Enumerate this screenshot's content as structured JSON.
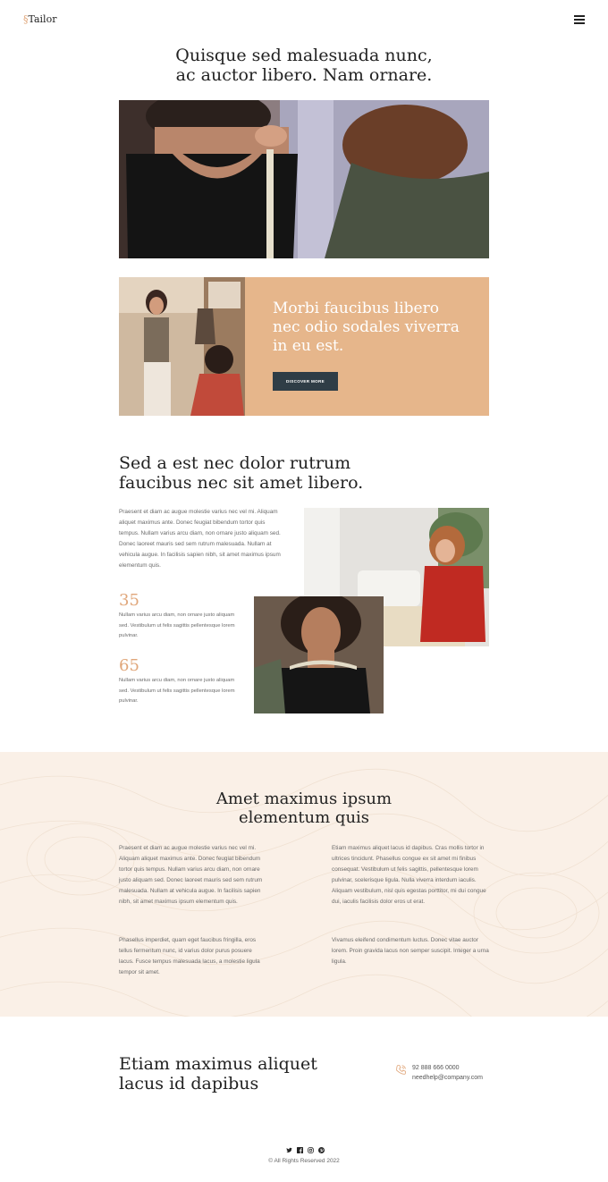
{
  "header": {
    "logo_mark": "§",
    "logo_text": "Tailor",
    "menu_icon": "hamburger-menu-icon"
  },
  "hero": {
    "title": "Quisque sed malesuada nunc, ac auctor libero. Nam ornare."
  },
  "promo": {
    "title": "Morbi faucibus libero nec odio sodales viverra in eu est.",
    "button_label": "DISCOVER MORE",
    "bg_color": "#e6b68b"
  },
  "about": {
    "title": "Sed a est nec dolor rutrum faucibus nec sit amet libero.",
    "body": "Praesent et diam ac augue molestie varius nec vel mi. Aliquam aliquet maximus ante. Donec feugiat bibendum tortor quis tempus. Nullam varius arcu diam, non ornare justo aliquam sed. Donec laoreet mauris sed sem rutrum malesuada. Nullam at vehicula augue. In facilisis sapien nibh, sit amet maximus ipsum elementum quis.",
    "stats": [
      {
        "number": "35",
        "text": "Nullam varius arcu diam, non ornare justo aliquam sed. Vestibulum ut felis sagittis pellentesque lorem pulvinar."
      },
      {
        "number": "65",
        "text": "Nullam varius arcu diam, non ornare justo aliquam sed. Vestibulum ut felis sagittis pellentesque lorem pulvinar."
      }
    ],
    "accent_color": "#e0a67a"
  },
  "features": {
    "title": "Amet maximus ipsum elementum quis",
    "bg_color": "#faf0e7",
    "col1_p1": "Praesent et diam ac augue molestie varius nec vel mi. Aliquam aliquet maximus ante. Donec feugiat bibendum tortor quis tempus. Nullam varius arcu diam, non ornare justo aliquam sed. Donec laoreet mauris sed sem rutrum malesuada. Nullam at vehicula augue. In facilisis sapien nibh, sit amet maximus ipsum elementum quis.",
    "col1_p2": "Phasellus imperdiet, quam eget faucibus fringilla, eros tellus fermentum nunc, id varius dolor purus posuere lacus. Fusce tempus malesuada lacus, a molestie ligula tempor sit amet.",
    "col2_p1": "Etiam maximus aliquet lacus id dapibus. Cras mollis tortor in ultrices tincidunt. Phasellus congue ex sit amet mi finibus consequat. Vestibulum ut felis sagittis, pellentesque lorem pulvinar, scelerisque ligula. Nulla viverra interdum iaculis. Aliquam vestibulum, nisl quis egestas porttitor, mi dui congue dui, iaculis facilisis dolor eros ut erat.",
    "col2_p2": "Vivamus eleifend condimentum luctus. Donec vitae auctor lorem. Proin gravida lacus non semper suscipit. Integer a urna ligula."
  },
  "contact": {
    "title": "Etiam maximus aliquet lacus id dapibus",
    "phone": "92 888 666 0000",
    "email": "needhelp@company.com",
    "phone_icon": "phone-icon"
  },
  "footer": {
    "social_icons": [
      "twitter-icon",
      "facebook-icon",
      "instagram-icon",
      "pinterest-icon"
    ],
    "copyright": "© All Rights Reserved 2022"
  }
}
